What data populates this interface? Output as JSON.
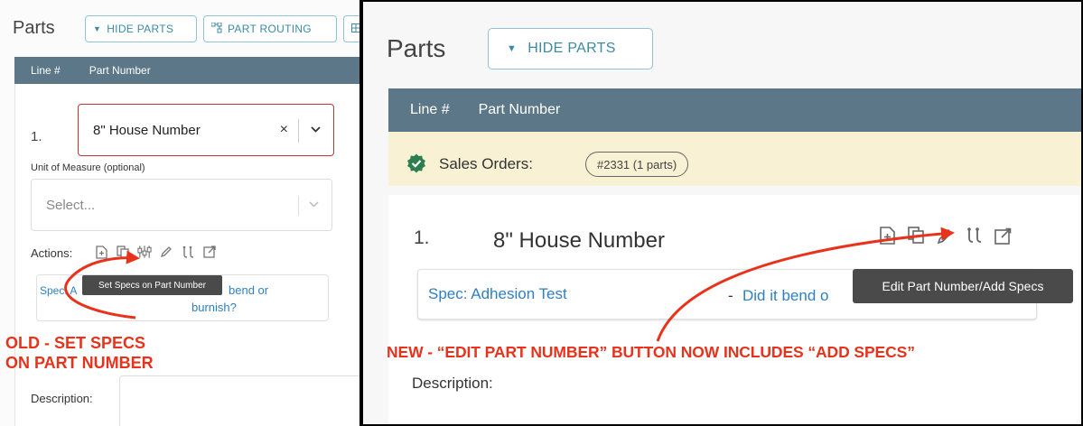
{
  "old": {
    "title": "Parts",
    "toolbar": {
      "hide_parts": "HIDE PARTS",
      "part_routing": "PART ROUTING"
    },
    "table_header": {
      "line": "Line #",
      "part_number": "Part Number"
    },
    "line": {
      "number": "1.",
      "part_value": "8\" House Number",
      "clear_glyph": "×",
      "chevron_glyph": "⌄"
    },
    "uom": {
      "label": "Unit of Measure (optional)",
      "placeholder": "Select..."
    },
    "actions_label": "Actions:",
    "action_icons": [
      "file-add-icon",
      "copy-icon",
      "specs-icon",
      "pencil-icon",
      "routing-icon",
      "external-link-icon"
    ],
    "spec": {
      "prefix": "Spec: A",
      "text_right": "bend or",
      "text_line2": "burnish?"
    },
    "tooltip": "Set Specs on Part Number",
    "description_label": "Description:",
    "callout_line1": "OLD - SET SPECS",
    "callout_line2": "ON PART NUMBER"
  },
  "new": {
    "title": "Parts",
    "toolbar": {
      "hide_parts": "HIDE PARTS"
    },
    "table_header": {
      "line": "Line #",
      "part_number": "Part Number"
    },
    "sales_orders": {
      "label": "Sales Orders:",
      "order_pill": "#2331 (1 parts)"
    },
    "line": {
      "number": "1.",
      "part_number": "8\" House Number"
    },
    "action_icons": [
      "file-add-icon",
      "copy-icon",
      "pencil-icon",
      "routing-icon",
      "external-link-icon"
    ],
    "spec": {
      "name": "Spec: Adhesion Test",
      "dash": "-",
      "question": "Did it bend o"
    },
    "tooltip": "Edit Part Number/Add Specs",
    "callout": "NEW - “EDIT PART NUMBER” BUTTON NOW INCLUDES “ADD SPECS”",
    "description_label": "Description:"
  },
  "colors": {
    "header_bg": "#5c7888",
    "accent": "#3d8aa3",
    "callout": "#e8331c",
    "link": "#2f7fc1",
    "banner_bg": "#f8f1d3",
    "success": "#2e7d4f",
    "error_border": "#c0392b"
  }
}
